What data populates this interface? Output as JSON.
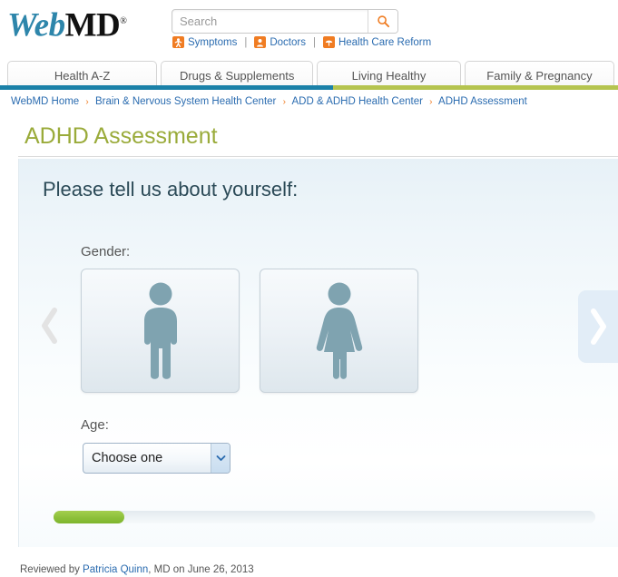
{
  "brand": {
    "logo_web": "Web",
    "logo_md": "MD",
    "registered_mark": "®"
  },
  "search": {
    "placeholder": "Search",
    "value": "",
    "button_icon": "search-icon"
  },
  "quicklinks": [
    {
      "label": "Symptoms",
      "icon": "symptoms-person-icon"
    },
    {
      "label": "Doctors",
      "icon": "doctor-person-icon"
    },
    {
      "label": "Health Care Reform",
      "icon": "umbrella-icon"
    }
  ],
  "quicklink_separator": "|",
  "tabs": [
    {
      "label": "Health A-Z"
    },
    {
      "label": "Drugs & Supplements"
    },
    {
      "label": "Living Healthy"
    },
    {
      "label": "Family & Pregnancy"
    }
  ],
  "tab_underline": {
    "left_color": "#1b81a8",
    "right_color": "#b5c44f"
  },
  "breadcrumb": {
    "separator": "›",
    "items": [
      {
        "label": "WebMD Home"
      },
      {
        "label": "Brain & Nervous System Health Center"
      },
      {
        "label": "ADD & ADHD Health Center"
      },
      {
        "label": "ADHD Assessment"
      }
    ]
  },
  "page_title": "ADHD Assessment",
  "panel": {
    "heading": "Please tell us about yourself:",
    "gender": {
      "label": "Gender:",
      "options": [
        {
          "value": "male",
          "icon": "male-figure-icon"
        },
        {
          "value": "female",
          "icon": "female-figure-icon"
        }
      ]
    },
    "age": {
      "label": "Age:",
      "selected": "Choose one",
      "options": [
        "Choose one"
      ],
      "arrow_icon": "chevron-down-icon"
    },
    "nav": {
      "prev_icon": "chevron-left-icon",
      "next_icon": "chevron-right-icon"
    },
    "progress": {
      "percent": 13,
      "fill_color": "#8cc03a",
      "track_color": "#e8eef2"
    }
  },
  "footer": {
    "reviewed_prefix": "Reviewed by ",
    "reviewer_name": "Patricia Quinn",
    "reviewer_credential": ", MD",
    "reviewed_suffix": " on June 26, 2013"
  },
  "colors": {
    "brand_blue": "#2e86ab",
    "accent_orange": "#f07c22",
    "title_olive": "#9aab3a",
    "link_blue": "#2b6cb0"
  }
}
